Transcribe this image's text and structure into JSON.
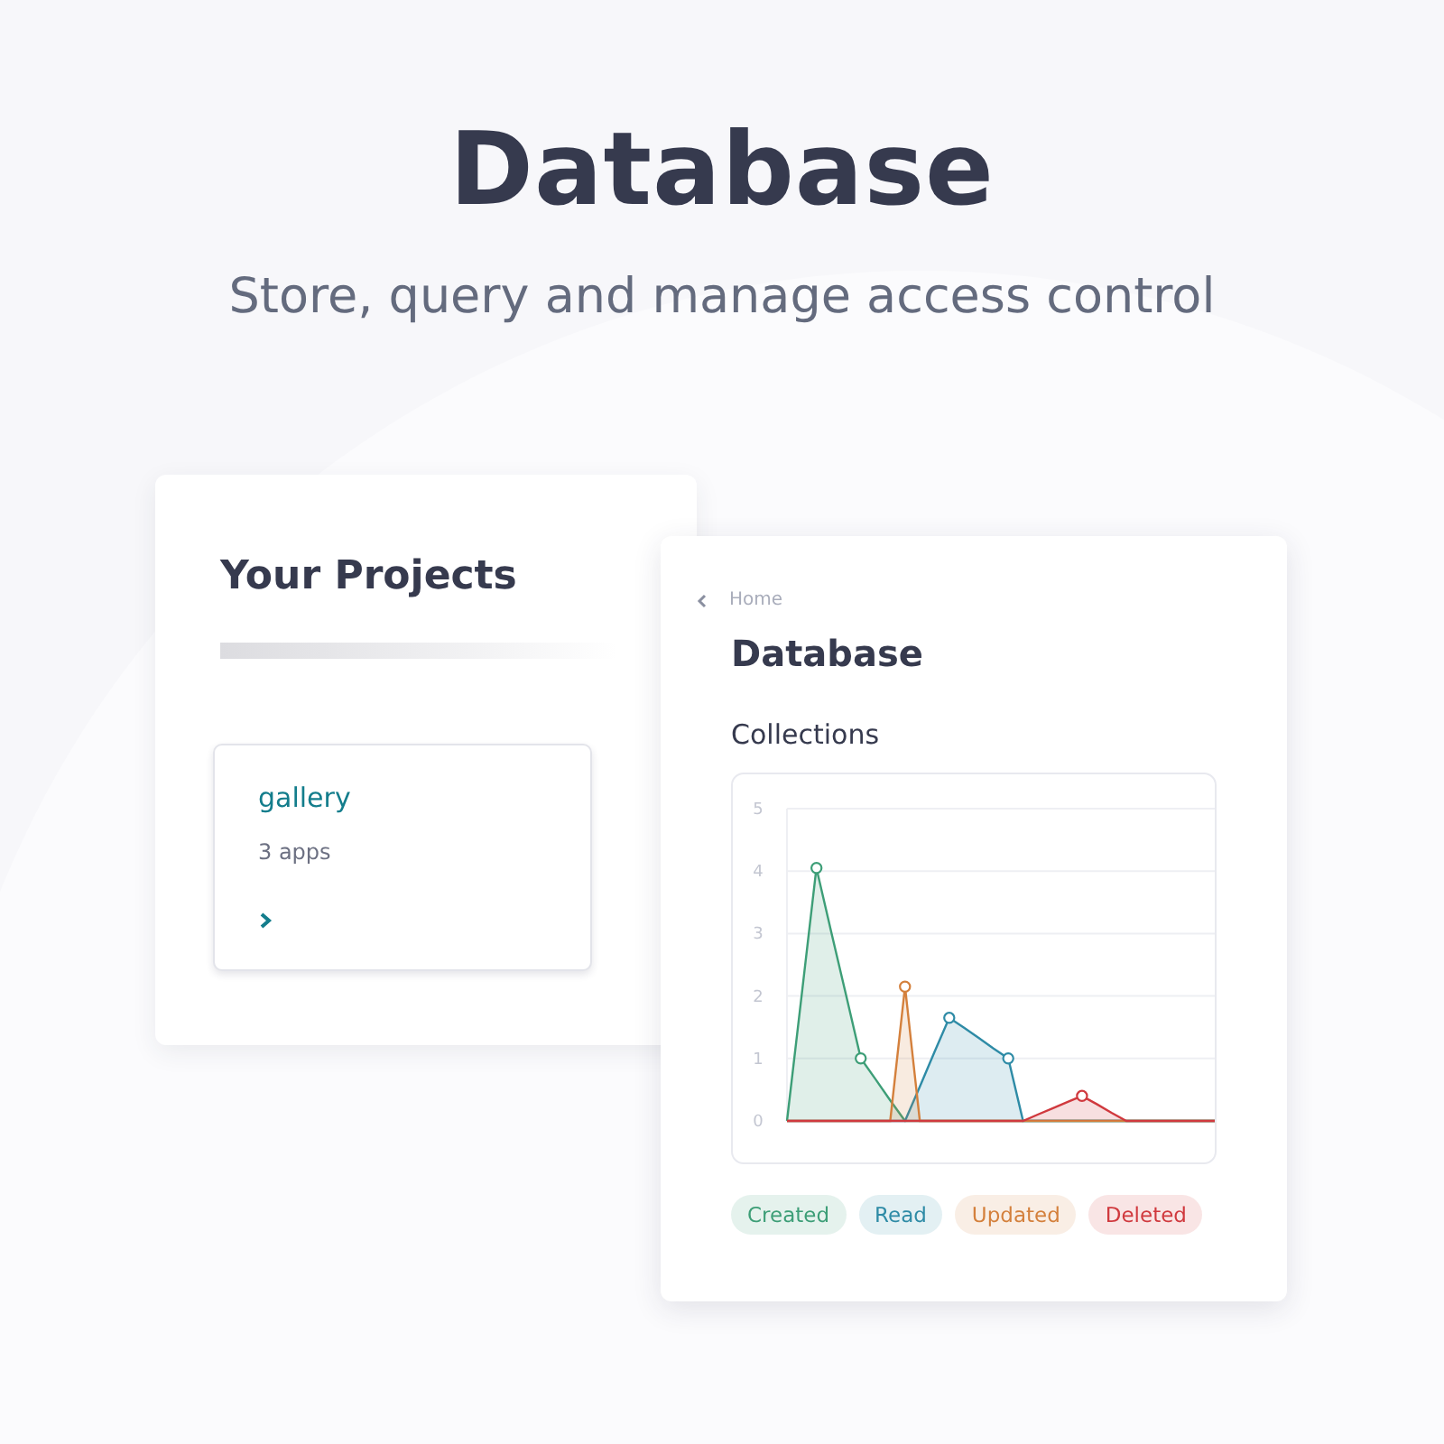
{
  "header": {
    "title": "Database",
    "subtitle": "Store, query and manage access control"
  },
  "projects_panel": {
    "title": "Your Projects",
    "projects": [
      {
        "name": "gallery",
        "apps": "3 apps"
      }
    ]
  },
  "database_panel": {
    "breadcrumb": "Home",
    "title": "Database",
    "section": "Collections",
    "chart_data": {
      "type": "area",
      "grid": true,
      "ylim": [
        0,
        5
      ],
      "yticks": [
        0,
        1,
        2,
        3,
        4,
        5
      ],
      "series": [
        {
          "name": "Created",
          "color": "#3d9e77",
          "values": [
            0,
            2.03,
            4.05,
            3.03,
            2.02,
            1,
            0.67,
            0.33,
            0,
            0,
            0,
            0,
            0,
            0,
            0,
            0,
            0,
            0,
            0,
            0,
            0,
            0,
            0,
            0,
            0,
            0,
            0,
            0,
            0,
            0
          ]
        },
        {
          "name": "Read",
          "color": "#2e8ba6",
          "values": [
            0,
            0,
            0,
            0,
            0,
            0,
            0,
            0,
            0,
            0.55,
            1.1,
            1.65,
            1.49,
            1.33,
            1.16,
            1,
            0,
            0,
            0,
            0,
            0,
            0,
            0,
            0,
            0,
            0,
            0,
            0,
            0,
            0
          ]
        },
        {
          "name": "Updated",
          "color": "#d4803c",
          "values": [
            0,
            0,
            0,
            0,
            0,
            0,
            0,
            0,
            2.15,
            0,
            0,
            0,
            0,
            0,
            0,
            0,
            0,
            0,
            0,
            0,
            0,
            0,
            0,
            0,
            0,
            0,
            0,
            0,
            0,
            0
          ]
        },
        {
          "name": "Deleted",
          "color": "#d0393e",
          "values": [
            0,
            0,
            0,
            0,
            0,
            0,
            0,
            0,
            0,
            0,
            0,
            0,
            0,
            0,
            0,
            0,
            0,
            0.1,
            0.2,
            0.3,
            0.4,
            0.27,
            0.13,
            0,
            0,
            0,
            0,
            0,
            0,
            0
          ]
        }
      ]
    }
  }
}
